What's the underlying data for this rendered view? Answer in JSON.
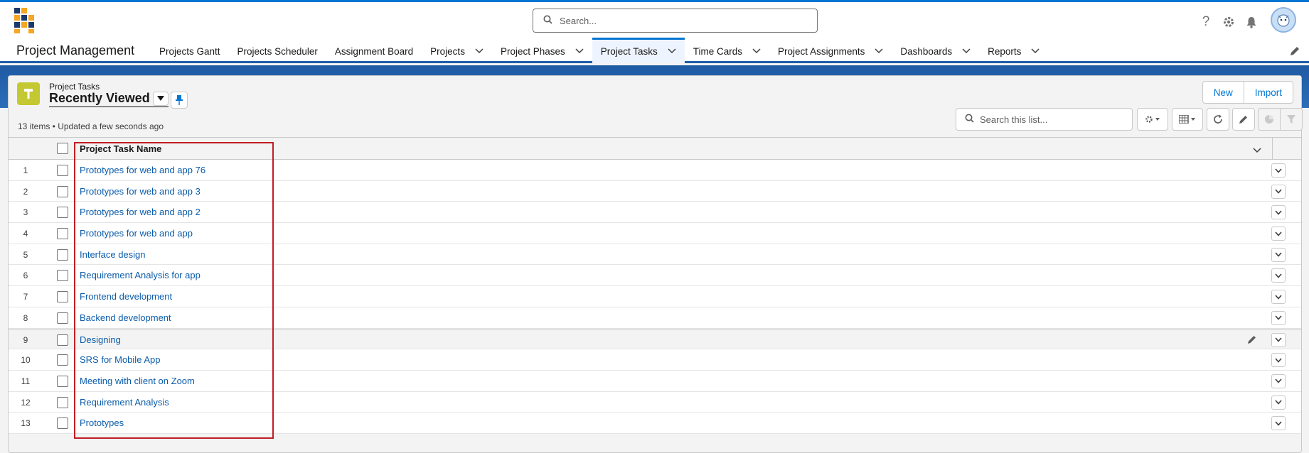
{
  "header": {
    "search_placeholder": "Search...",
    "icons": [
      "help-icon",
      "setup-gear-icon",
      "notification-bell-icon",
      "user-avatar"
    ]
  },
  "nav": {
    "app_name": "Project Management",
    "items": [
      {
        "label": "Projects Gantt",
        "dropdown": false,
        "active": false
      },
      {
        "label": "Projects Scheduler",
        "dropdown": false,
        "active": false
      },
      {
        "label": "Assignment Board",
        "dropdown": false,
        "active": false
      },
      {
        "label": "Projects",
        "dropdown": true,
        "active": false
      },
      {
        "label": "Project Phases",
        "dropdown": true,
        "active": false
      },
      {
        "label": "Project Tasks",
        "dropdown": true,
        "active": true
      },
      {
        "label": "Time Cards",
        "dropdown": true,
        "active": false
      },
      {
        "label": "Project Assignments",
        "dropdown": true,
        "active": false
      },
      {
        "label": "Dashboards",
        "dropdown": true,
        "active": false
      },
      {
        "label": "Reports",
        "dropdown": true,
        "active": false
      }
    ]
  },
  "list": {
    "object_label": "Project Tasks",
    "view_name": "Recently Viewed",
    "meta": "13 items • Updated a few seconds ago",
    "new_label": "New",
    "import_label": "Import",
    "search_placeholder": "Search this list...",
    "column_header": "Project Task Name",
    "rows": [
      {
        "num": "1",
        "name": "Prototypes for web and app 76"
      },
      {
        "num": "2",
        "name": "Prototypes for web and app 3"
      },
      {
        "num": "3",
        "name": "Prototypes for web and app 2"
      },
      {
        "num": "4",
        "name": "Prototypes for web and app"
      },
      {
        "num": "5",
        "name": "Interface design"
      },
      {
        "num": "6",
        "name": "Requirement Analysis for app"
      },
      {
        "num": "7",
        "name": "Frontend development"
      },
      {
        "num": "8",
        "name": "Backend development"
      },
      {
        "num": "9",
        "name": "Designing"
      },
      {
        "num": "10",
        "name": "SRS for Mobile App"
      },
      {
        "num": "11",
        "name": "Meeting with client on Zoom"
      },
      {
        "num": "12",
        "name": "Requirement Analysis"
      },
      {
        "num": "13",
        "name": "Prototypes"
      }
    ]
  },
  "colors": {
    "brand": "#0176d3",
    "link": "#0b5cab",
    "object_icon": "#c4c832",
    "highlight": "#c21e25"
  }
}
